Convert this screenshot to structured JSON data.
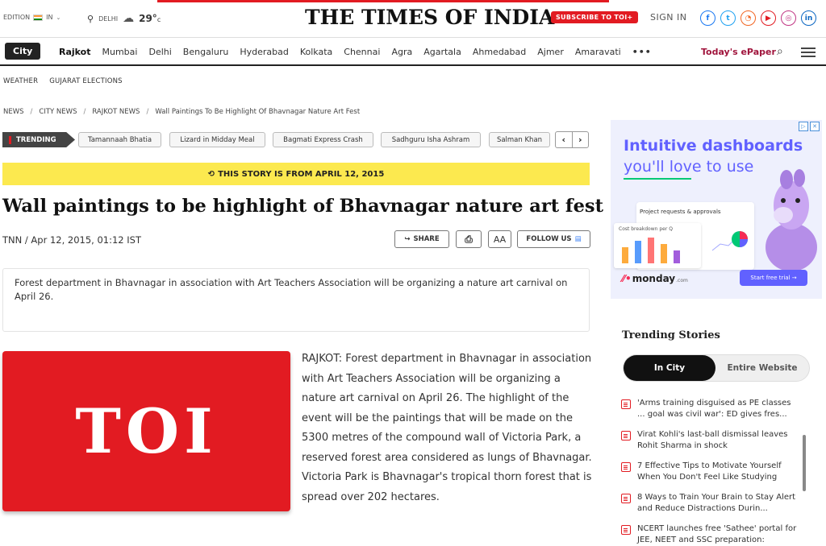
{
  "header": {
    "edition_label": "EDITION",
    "edition_value": "IN",
    "location": "DELHI",
    "temperature": "29°",
    "temperature_unit": "c",
    "logo": "THE TIMES OF INDIA",
    "subscribe_label": "SUBSCRIBE TO TOI+",
    "signin_label": "SIGN IN",
    "socials": [
      {
        "name": "facebook-icon",
        "glyph": "f",
        "color": "#1877f2"
      },
      {
        "name": "twitter-icon",
        "glyph": "t",
        "color": "#1da1f2"
      },
      {
        "name": "rss-icon",
        "glyph": "◔",
        "color": "#f26522"
      },
      {
        "name": "youtube-icon",
        "glyph": "▶",
        "color": "#e21b22"
      },
      {
        "name": "instagram-icon",
        "glyph": "◎",
        "color": "#c13584"
      },
      {
        "name": "linkedin-icon",
        "glyph": "in",
        "color": "#0a66c2"
      }
    ]
  },
  "nav": {
    "city_label": "City",
    "items": [
      "Rajkot",
      "Mumbai",
      "Delhi",
      "Bengaluru",
      "Hyderabad",
      "Kolkata",
      "Chennai",
      "Agra",
      "Agartala",
      "Ahmedabad",
      "Ajmer",
      "Amaravati"
    ],
    "more": "•••",
    "epaper": "Today's ePaper"
  },
  "subnav": [
    "WEATHER",
    "GUJARAT ELECTIONS"
  ],
  "breadcrumb": [
    "NEWS",
    "CITY NEWS",
    "RAJKOT NEWS",
    "Wall Paintings To Be Highlight Of Bhavnagar Nature Art Fest"
  ],
  "trending": {
    "label": "TRENDING",
    "chips": [
      "Tamannaah Bhatia",
      "Lizard in Midday Meal",
      "Bagmati Express Crash",
      "Sadhguru Isha Ashram",
      "Salman Khan"
    ]
  },
  "article": {
    "story_banner": "THIS STORY IS FROM APRIL 12, 2015",
    "headline": "Wall paintings to be highlight of Bhavnagar nature art fest",
    "byline": "TNN / Apr 12, 2015, 01:12 IST",
    "share_label": "SHARE",
    "font_label": "AA",
    "follow_label": "FOLLOW US",
    "summary": "Forest department in Bhavnagar in association with Art Teachers Association will be organizing a nature art carnival on April 26.",
    "hero_text": "TOI",
    "body_p1": "RAJKOT: Forest department in Bhavnagar in association with Art Teachers Association will be organizing a nature art carnival on April 26. The highlight of the event will be the paintings that will be made on the 5300 metres of the compound wall of Victoria Park, a reserved forest area considered as lungs of Bhavnagar.",
    "body_p2": "Victoria Park is Bhavnagar's tropical thorn forest that is spread over 202 hectares."
  },
  "ad": {
    "headline1": "Intuitive dashboards",
    "headline2": "you'll love to use",
    "card_title": "Project requests & approvals",
    "chart_title": "Cost breakdown per Q",
    "brand": "monday",
    "brand_suffix": ".com",
    "cta": "Start free trial →",
    "accent": "#6161ff"
  },
  "trending_stories": {
    "title": "Trending Stories",
    "tabs": [
      "In City",
      "Entire Website"
    ],
    "items": [
      "'Arms training disguised as PE classes ... goal was civil war': ED gives fres...",
      "Virat Kohli's last-ball dismissal leaves Rohit Sharma in shock",
      "7 Effective Tips to Motivate Yourself When You Don't Feel Like Studying",
      "8 Ways to Train Your Brain to Stay Alert and Reduce Distractions Durin...",
      "NCERT launches free 'Sathee' portal for JEE, NEET and SSC preparation:"
    ]
  }
}
